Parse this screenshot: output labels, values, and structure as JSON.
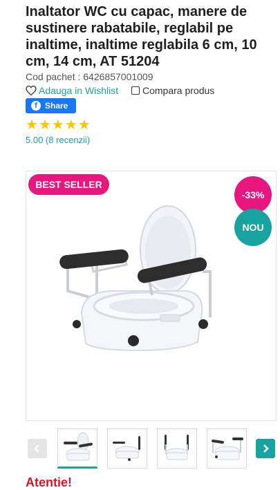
{
  "product": {
    "title": "Inaltator WC cu capac, manere de sustinere rabatabile, reglabil pe inaltime, inaltime reglabila 6 cm, 10 cm, 14 cm, AT 51204",
    "code": "Cod pachet : 6426857001009",
    "wishlist_label": "Adauga in Wishlist",
    "compare_label": "Compara produs",
    "share_label": "Share",
    "rating_text": "5.00 (8 recenzii)",
    "stars": 5
  },
  "badges": {
    "best_seller": "BEST SELLER",
    "discount": "-33%",
    "new": "NOU"
  },
  "gallery": {
    "active_thumb": 1,
    "thumbs": [
      "thumb-1",
      "thumb-2",
      "thumb-3",
      "thumb-4"
    ]
  },
  "notice": {
    "label": "Atentie!"
  },
  "colors": {
    "accent_teal": "#19a3a0",
    "badge_pink": "#e8177f",
    "star_yellow": "#f7c600",
    "facebook_blue": "#1877f2"
  }
}
